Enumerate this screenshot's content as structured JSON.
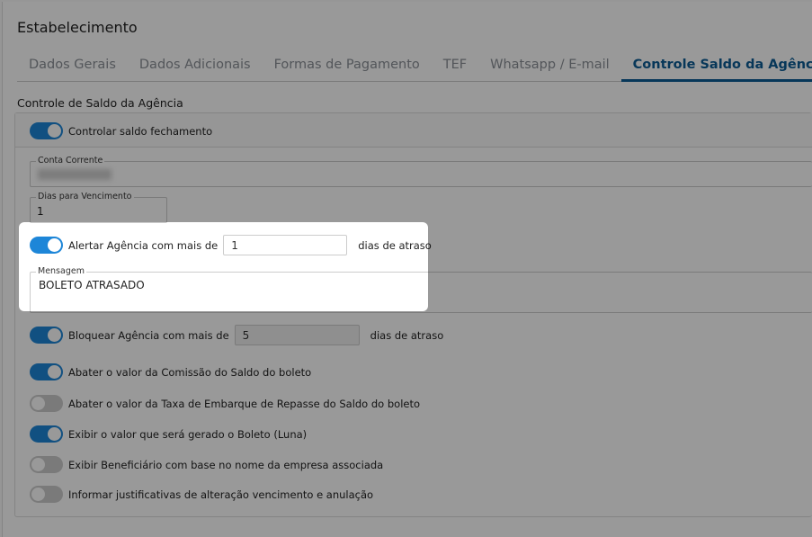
{
  "header": {
    "title": "Estabelecimento"
  },
  "tabs": [
    {
      "label": "Dados Gerais"
    },
    {
      "label": "Dados Adicionais"
    },
    {
      "label": "Formas de Pagamento"
    },
    {
      "label": "TEF"
    },
    {
      "label": "Whatsapp / E-mail"
    },
    {
      "label": "Controle Saldo da Agência",
      "active": true
    }
  ],
  "section": {
    "title": "Controle de Saldo da Agência"
  },
  "controlar": {
    "label": "Controlar saldo fechamento",
    "on": true
  },
  "conta_corrente": {
    "label": "Conta Corrente"
  },
  "dias_vencimento": {
    "label": "Dias para Vencimento",
    "value": "1"
  },
  "alertar": {
    "label": "Alertar Agência com mais de",
    "value": "1",
    "suffix": "dias de atraso",
    "on": true
  },
  "mensagem": {
    "label": "Mensagem",
    "value": "BOLETO ATRASADO"
  },
  "bloquear": {
    "label": "Bloquear Agência com mais de",
    "value": "5",
    "suffix": "dias de atraso",
    "on": true
  },
  "options": [
    {
      "label": "Abater o valor da Comissão do Saldo do boleto",
      "on": true
    },
    {
      "label": "Abater o valor da Taxa de Embarque de Repasse do Saldo do boleto",
      "on": false
    },
    {
      "label": "Exibir o valor que será gerado o Boleto (Luna)",
      "on": true
    },
    {
      "label": "Exibir Beneficiário com base no nome da empresa associada",
      "on": false
    },
    {
      "label": "Informar justificativas de alteração vencimento e anulação",
      "on": false
    }
  ],
  "colors": {
    "accent": "#0d5c95",
    "toggle_on": "#1d86d8",
    "toggle_off": "#cccccc"
  }
}
